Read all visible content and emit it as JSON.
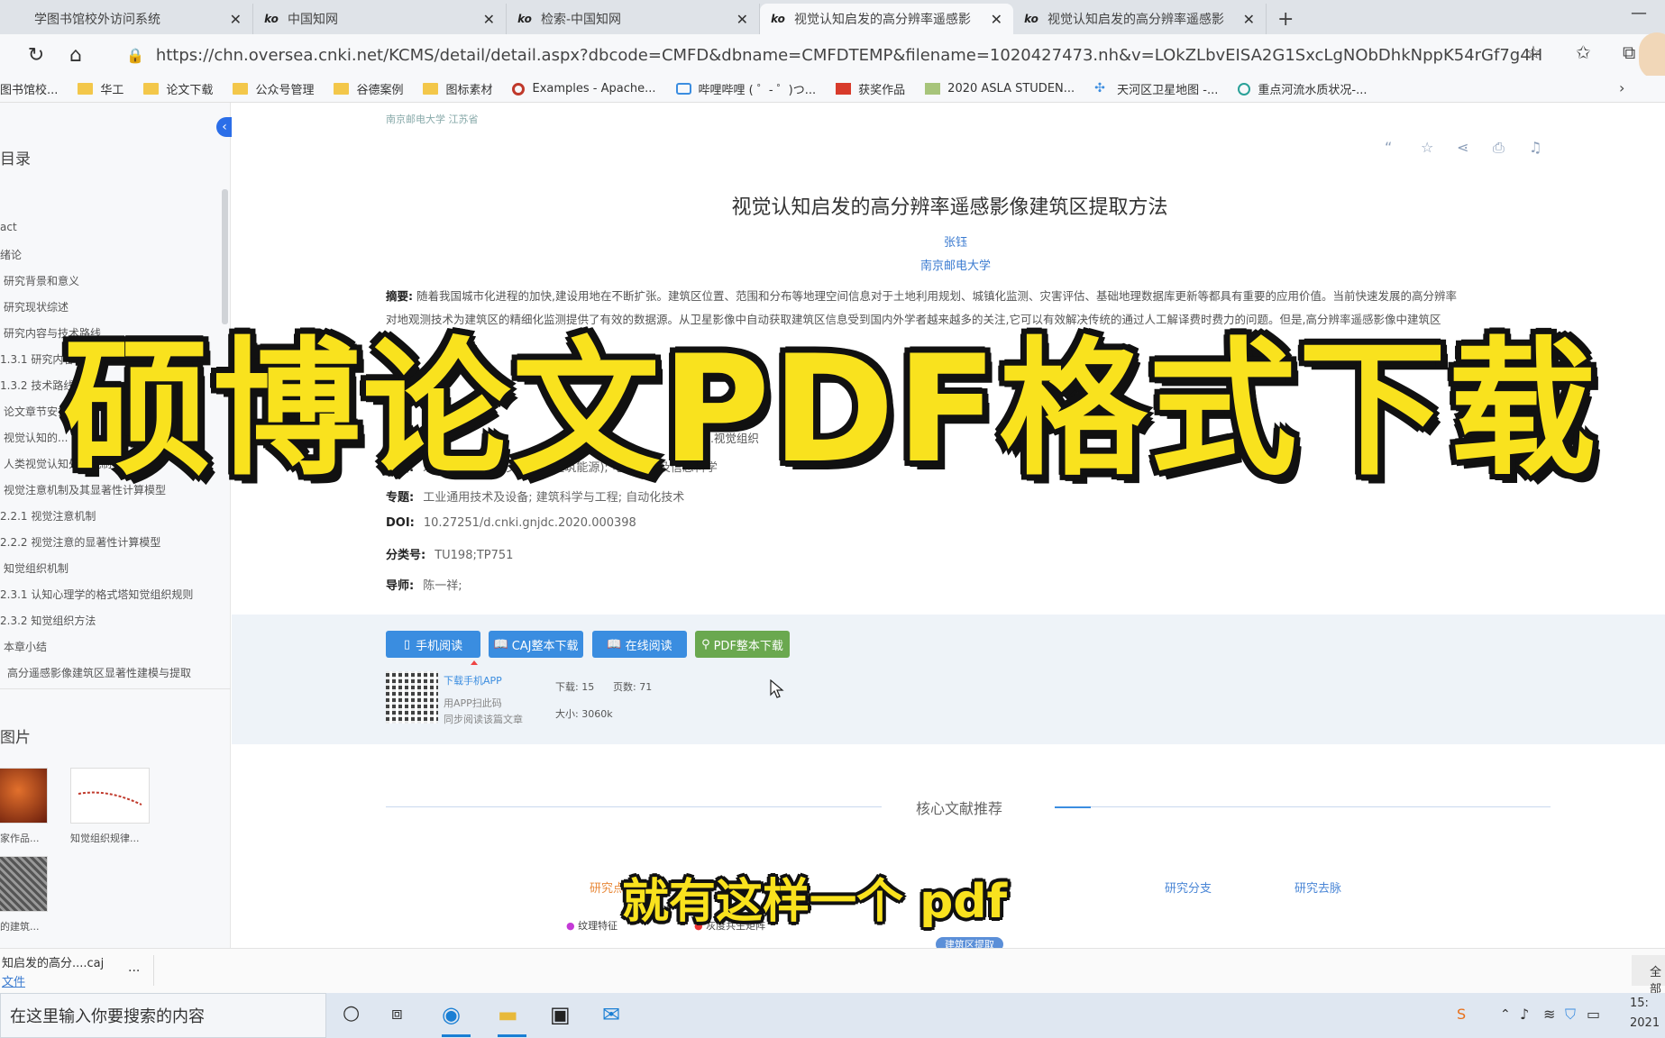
{
  "tabs": [
    {
      "title": "学图书馆校外访问系统",
      "active": false
    },
    {
      "title": "中国知网",
      "active": false
    },
    {
      "title": "检索-中国知网",
      "active": false
    },
    {
      "title": "视觉认知启发的高分辨率遥感影",
      "active": true
    },
    {
      "title": "视觉认知启发的高分辨率遥感影",
      "active": false
    }
  ],
  "address": {
    "url": "https://chn.oversea.cnki.net/KCMS/detail/detail.aspx?dbcode=CMFD&dbname=CMFDTEMP&filename=1020427473.nh&v=LOkZLbvEISA2G1SxcLgNObDhkNppK54rGf7g4HL%25m..."
  },
  "bookmarks": [
    "图书馆校...",
    "华工",
    "论文下载",
    "公众号管理",
    "谷德案例",
    "图标素材",
    "Examples - Apache...",
    "哔哩哔哩 ( ゜- ゜)つ...",
    "获奖作品",
    "2020 ASLA STUDEN...",
    "天河区卫星地图 -...",
    "重点河流水质状况-..."
  ],
  "sidebar": {
    "toc_title": "目录",
    "toc": [
      "act",
      "绪论",
      "研究背景和意义",
      "研究现状综述",
      "研究内容与技术路线",
      "1.3.1 研究内容",
      "1.3.2 技术路线",
      "论文章节安排",
      "视觉认知的...",
      "人类视觉认知处理机制",
      "视觉注意机制及其显著性计算模型",
      "2.2.1 视觉注意机制",
      "2.2.2 视觉注意的显著性计算模型",
      "知觉组织机制",
      "2.3.1 认知心理学的格式塔知觉组织规则",
      "2.3.2 知觉组织方法",
      "本章小结",
      "高分遥感影像建筑区显著性建模与提取"
    ],
    "images_title": "图片",
    "images": [
      {
        "caption": "家作品..."
      },
      {
        "caption": "知觉组织规律..."
      },
      {
        "caption": "的建筑..."
      }
    ]
  },
  "paper": {
    "institution": "南京邮电大学  江苏省",
    "title": "视觉认知启发的高分辨率遥感影像建筑区提取方法",
    "author": "张钰",
    "school": "南京邮电大学",
    "abstract_label": "摘要:",
    "abstract_lines": [
      "随着我国城市化进程的加快,建设用地在不断扩张。建筑区位置、范围和分布等地理空间信息对于土地利用规划、城镇化监测、灾害评估、基础地理数据库更新等都具有重要的应用价值。当前快速发展的高分辨率",
      "对地观测技术为建筑区的精细化监测提供了有效的数据源。从卫星影像中自动获取建筑区信息受到国内外学者越来越多的关注,它可以有效解决传统的通过人工解译费时费力的问题。但是,高分辨率遥感影像中建筑区",
      "",
      "",
      ""
    ],
    "keywords_tail": "...视觉组织",
    "fields": [
      {
        "label": "专辑:",
        "value": "理工C(机电航空交通水利建筑能源); 电子技术及信息科学"
      },
      {
        "label": "专题:",
        "value": "工业通用技术及设备; 建筑科学与工程; 自动化技术"
      },
      {
        "label": "DOI:",
        "value": "10.27251/d.cnki.gnjdc.2020.000398"
      },
      {
        "label": "分类号:",
        "value": "TU198;TP751"
      },
      {
        "label": "导师:",
        "value": "陈一祥;"
      }
    ]
  },
  "actions": {
    "mobile_read": "手机阅读",
    "caj_download": "CAJ整本下载",
    "online_read": "在线阅读",
    "pdf_download": "PDF整本下载",
    "app_download": "下载手机APP",
    "app_note1": "用APP扫此码",
    "app_note2": "同步阅读该篇文章",
    "downloads": "下载: 15",
    "pages": "页数: 71",
    "size": "大小: 3060k"
  },
  "recommend": {
    "title": "核心文献推荐",
    "tabs": [
      "研究点",
      "研究分支",
      "研究去脉"
    ],
    "items": [
      "纹理特征",
      "灰度共生矩阵",
      "建筑区提取"
    ]
  },
  "overlay": {
    "title": "硕博论文PDF格式下载",
    "subtitle": "就有这样一个 pdf"
  },
  "download_bar": {
    "file": "知启发的高分....caj",
    "link": "文件",
    "more": "...",
    "right": "全部"
  },
  "taskbar": {
    "search_placeholder": "在这里输入你要搜索的内容",
    "time": "15:",
    "date": "2021"
  },
  "colors": {
    "accent_blue": "#3a8de0",
    "pdf_green": "#6aa84f",
    "overlay_yellow": "#f9e21e"
  }
}
